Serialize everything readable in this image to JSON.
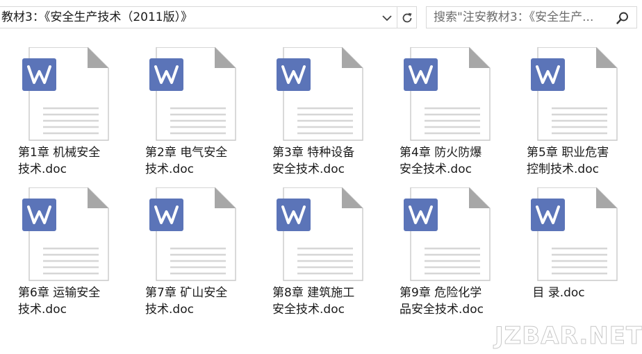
{
  "address_bar": {
    "path": "教材3：《安全生产技术（2011版）》",
    "chevron_icon": "chevron-down-icon",
    "refresh_icon": "refresh-icon"
  },
  "search_box": {
    "placeholder": "搜索\"注安教材3：《安全生产...",
    "icon": "search-icon"
  },
  "files": [
    {
      "name": "第1章  机械安全\n技术.doc",
      "icon": "wps-word-doc-icon"
    },
    {
      "name": "第2章  电气安全\n技术.doc",
      "icon": "wps-word-doc-icon"
    },
    {
      "name": "第3章  特种设备\n安全技术.doc",
      "icon": "wps-word-doc-icon"
    },
    {
      "name": "第4章  防火防爆\n安全技术.doc",
      "icon": "wps-word-doc-icon"
    },
    {
      "name": "第5章  职业危害\n控制技术.doc",
      "icon": "wps-word-doc-icon"
    },
    {
      "name": "第6章  运输安全\n技术.doc",
      "icon": "wps-word-doc-icon"
    },
    {
      "name": "第7章  矿山安全\n技术.doc",
      "icon": "wps-word-doc-icon"
    },
    {
      "name": "第8章  建筑施工\n安全技术.doc",
      "icon": "wps-word-doc-icon"
    },
    {
      "name": "第9章  危险化学\n品安全技术.doc",
      "icon": "wps-word-doc-icon"
    },
    {
      "name": "目  录.doc",
      "icon": "wps-word-doc-icon"
    }
  ],
  "colors": {
    "word_badge": "#5b74b8",
    "page_fill": "#ffffff",
    "page_border": "#c9c9c9",
    "fold": "#a7a7a7",
    "lines": "#d6d6d6"
  },
  "watermark": "JZBAR.NET"
}
